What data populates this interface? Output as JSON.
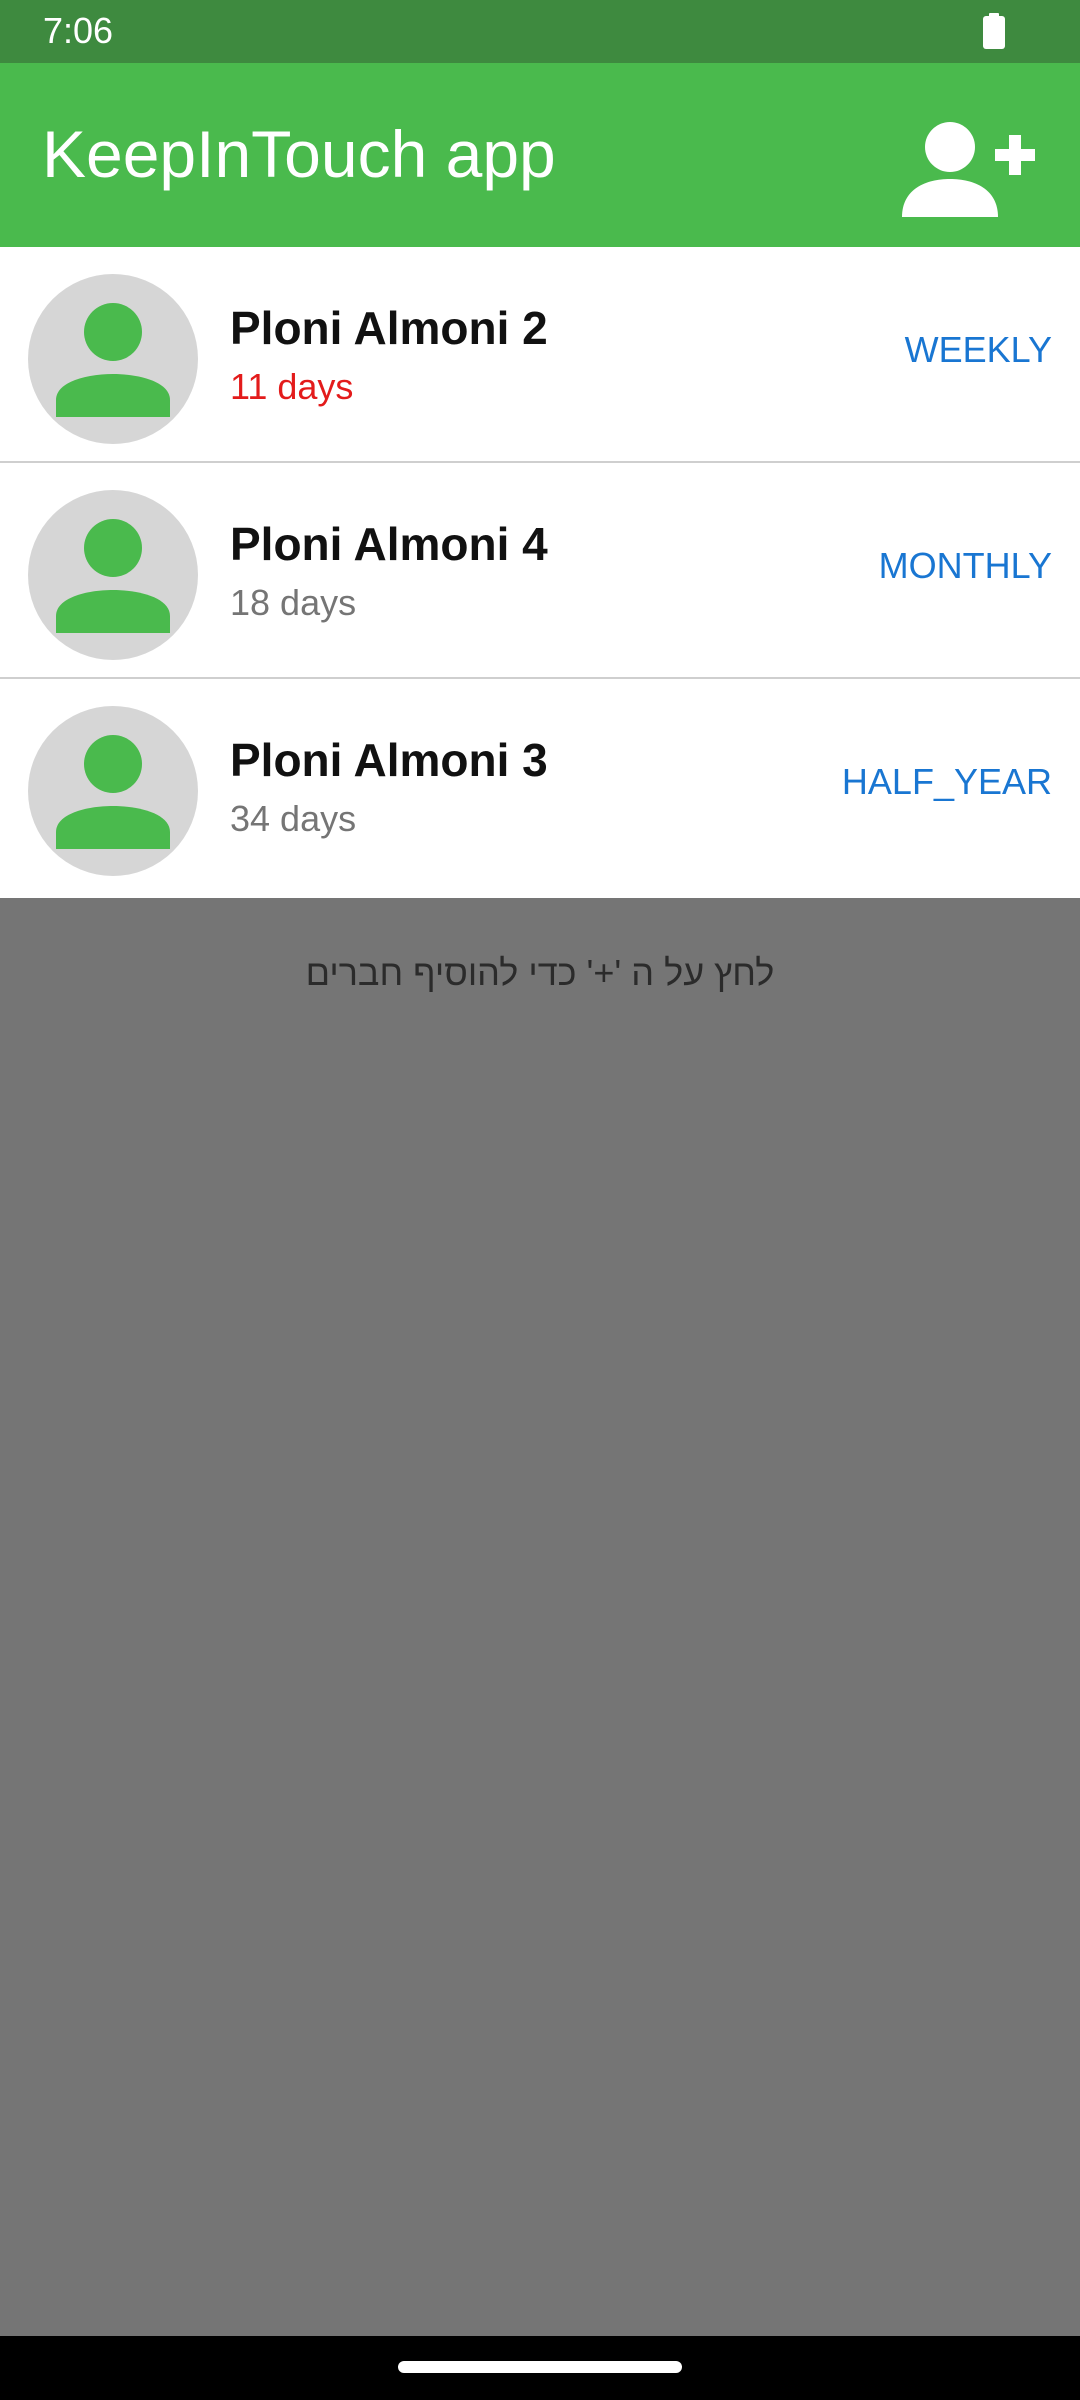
{
  "status_bar": {
    "time": "7:06",
    "battery_icon": "battery-full-icon"
  },
  "app_bar": {
    "title": "KeepInTouch app",
    "add_icon": "person-add-icon",
    "color": "#4aba4d"
  },
  "contacts": [
    {
      "name": "Ploni Almoni 2",
      "days": "11 days",
      "frequency": "WEEKLY",
      "overdue": true
    },
    {
      "name": "Ploni Almoni 4",
      "days": "18 days",
      "frequency": "MONTHLY",
      "overdue": false
    },
    {
      "name": "Ploni Almoni 3",
      "days": "34 days",
      "frequency": "HALF_YEAR",
      "overdue": false
    }
  ],
  "hint": "לחץ על ה '+' כדי להוסיף חברים",
  "colors": {
    "status_bar": "#3e8a3f",
    "accent_green": "#4aba4d",
    "overdue_red": "#e31b1b",
    "frequency_blue": "#1976d2",
    "scrim": "#757575"
  }
}
